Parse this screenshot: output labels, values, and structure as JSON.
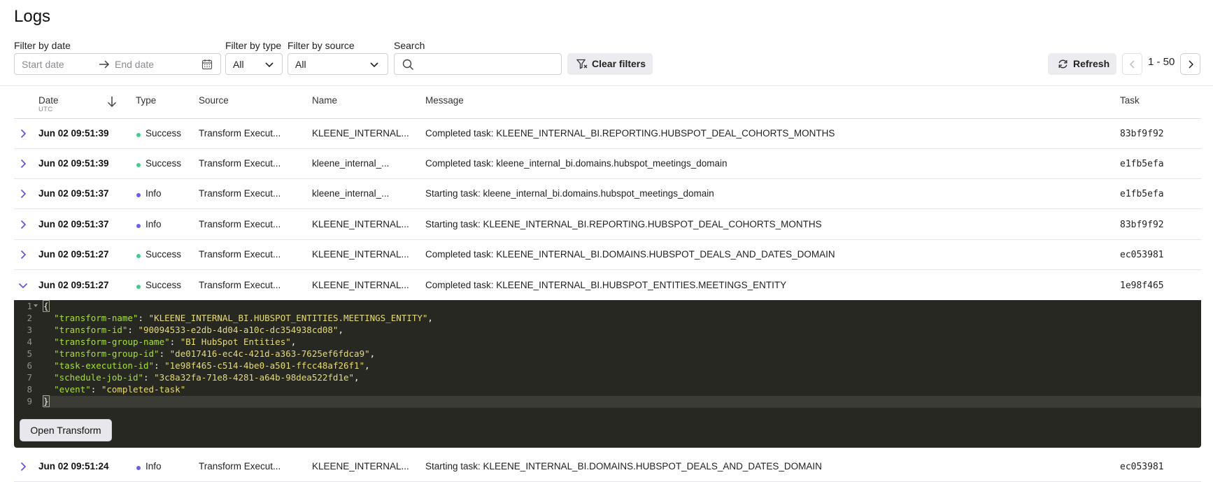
{
  "page": {
    "title": "Logs"
  },
  "filters": {
    "date_label": "Filter by date",
    "start_placeholder": "Start date",
    "end_placeholder": "End date",
    "type_label": "Filter by type",
    "type_value": "All",
    "source_label": "Filter by source",
    "source_value": "All",
    "search_label": "Search",
    "search_value": "",
    "clear_label": "Clear filters"
  },
  "toolbar": {
    "refresh_label": "Refresh",
    "page_range": "1 - 50"
  },
  "table": {
    "columns": {
      "date": "Date",
      "date_sub": "UTC",
      "type": "Type",
      "source": "Source",
      "name": "Name",
      "message": "Message",
      "task": "Task"
    },
    "rows": [
      {
        "date": "Jun 02 09:51:39",
        "type": "Success",
        "source": "Transform Execut...",
        "name": "KLEENE_INTERNAL...",
        "message": "Completed task: KLEENE_INTERNAL_BI.REPORTING.HUBSPOT_DEAL_COHORTS_MONTHS",
        "task": "83bf9f92"
      },
      {
        "date": "Jun 02 09:51:39",
        "type": "Success",
        "source": "Transform Execut...",
        "name": "kleene_internal_...",
        "message": "Completed task: kleene_internal_bi.domains.hubspot_meetings_domain",
        "task": "e1fb5efa"
      },
      {
        "date": "Jun 02 09:51:37",
        "type": "Info",
        "source": "Transform Execut...",
        "name": "kleene_internal_...",
        "message": "Starting task: kleene_internal_bi.domains.hubspot_meetings_domain",
        "task": "e1fb5efa"
      },
      {
        "date": "Jun 02 09:51:37",
        "type": "Info",
        "source": "Transform Execut...",
        "name": "KLEENE_INTERNAL...",
        "message": "Starting task: KLEENE_INTERNAL_BI.REPORTING.HUBSPOT_DEAL_COHORTS_MONTHS",
        "task": "83bf9f92"
      },
      {
        "date": "Jun 02 09:51:27",
        "type": "Success",
        "source": "Transform Execut...",
        "name": "KLEENE_INTERNAL...",
        "message": "Completed task: KLEENE_INTERNAL_BI.DOMAINS.HUBSPOT_DEALS_AND_DATES_DOMAIN",
        "task": "ec053981"
      },
      {
        "date": "Jun 02 09:51:27",
        "type": "Success",
        "source": "Transform Execut...",
        "name": "KLEENE_INTERNAL...",
        "message": "Completed task: KLEENE_INTERNAL_BI.HUBSPOT_ENTITIES.MEETINGS_ENTITY",
        "task": "1e98f465"
      },
      {
        "date": "Jun 02 09:51:24",
        "type": "Info",
        "source": "Transform Execut...",
        "name": "KLEENE_INTERNAL...",
        "message": "Starting task: KLEENE_INTERNAL_BI.DOMAINS.HUBSPOT_DEALS_AND_DATES_DOMAIN",
        "task": "ec053981"
      }
    ]
  },
  "expanded": {
    "line_numbers": [
      "1",
      "2",
      "3",
      "4",
      "5",
      "6",
      "7",
      "8",
      "9"
    ],
    "open_brace": "{",
    "close_brace": "}",
    "entries": [
      {
        "key": "\"transform-name\"",
        "value": "\"KLEENE_INTERNAL_BI.HUBSPOT_ENTITIES.MEETINGS_ENTITY\""
      },
      {
        "key": "\"transform-id\"",
        "value": "\"90094533-e2db-4d04-a10c-dc354938cd08\""
      },
      {
        "key": "\"transform-group-name\"",
        "value": "\"BI HubSpot Entities\""
      },
      {
        "key": "\"transform-group-id\"",
        "value": "\"de017416-ec4c-421d-a363-7625ef6fdca9\""
      },
      {
        "key": "\"task-execution-id\"",
        "value": "\"1e98f465-c514-4be0-a501-ffcc48af26f1\""
      },
      {
        "key": "\"schedule-job-id\"",
        "value": "\"3c8a32fa-71e8-4281-a64b-98dea522fd1e\""
      },
      {
        "key": "\"event\"",
        "value": "\"completed-task\""
      }
    ],
    "open_button_label": "Open Transform"
  },
  "colors": {
    "success_dot": "#3ecf8e",
    "info_dot": "#6b5cf6",
    "chevron": "#5b4ee0"
  }
}
